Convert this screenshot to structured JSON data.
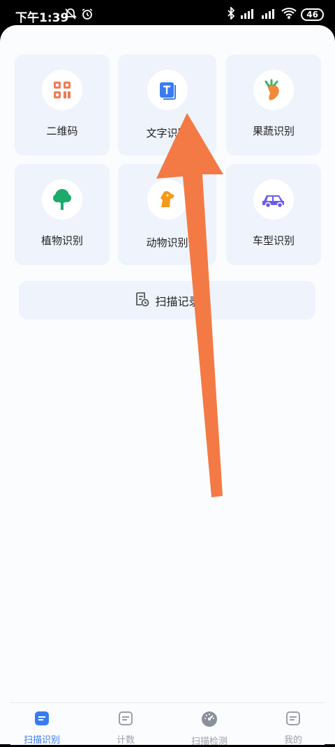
{
  "status": {
    "time": "下午1:39",
    "battery": "46"
  },
  "features": [
    {
      "label": "二维码",
      "icon": "qr-code-icon",
      "color": "#f07b55"
    },
    {
      "label": "文字识别",
      "icon": "text-icon",
      "color": "#3a7bf2"
    },
    {
      "label": "果蔬识别",
      "icon": "carrot-icon",
      "color": "#f08a3a"
    },
    {
      "label": "植物识别",
      "icon": "tree-icon",
      "color": "#1bab6b"
    },
    {
      "label": "动物识别",
      "icon": "dog-icon",
      "color": "#f59b17"
    },
    {
      "label": "车型识别",
      "icon": "car-icon",
      "color": "#6b5cf0"
    }
  ],
  "record_button": {
    "label": "扫描记录"
  },
  "nav": [
    {
      "label": "扫描识别",
      "active": true
    },
    {
      "label": "计数",
      "active": false
    },
    {
      "label": "扫描检测",
      "active": false
    },
    {
      "label": "我的",
      "active": false
    }
  ],
  "colors": {
    "accent": "#3a7bf2",
    "card_bg": "#eef3fc",
    "arrow": "#f47a45"
  }
}
